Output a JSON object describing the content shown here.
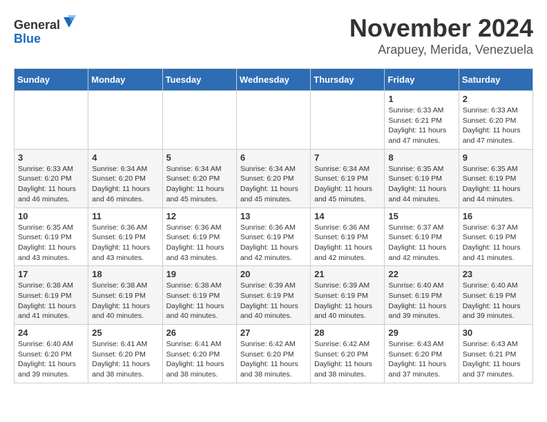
{
  "logo": {
    "general": "General",
    "blue": "Blue"
  },
  "title": "November 2024",
  "location": "Arapuey, Merida, Venezuela",
  "weekdays": [
    "Sunday",
    "Monday",
    "Tuesday",
    "Wednesday",
    "Thursday",
    "Friday",
    "Saturday"
  ],
  "weeks": [
    [
      {
        "day": "",
        "info": ""
      },
      {
        "day": "",
        "info": ""
      },
      {
        "day": "",
        "info": ""
      },
      {
        "day": "",
        "info": ""
      },
      {
        "day": "",
        "info": ""
      },
      {
        "day": "1",
        "info": "Sunrise: 6:33 AM\nSunset: 6:21 PM\nDaylight: 11 hours and 47 minutes."
      },
      {
        "day": "2",
        "info": "Sunrise: 6:33 AM\nSunset: 6:20 PM\nDaylight: 11 hours and 47 minutes."
      }
    ],
    [
      {
        "day": "3",
        "info": "Sunrise: 6:33 AM\nSunset: 6:20 PM\nDaylight: 11 hours and 46 minutes."
      },
      {
        "day": "4",
        "info": "Sunrise: 6:34 AM\nSunset: 6:20 PM\nDaylight: 11 hours and 46 minutes."
      },
      {
        "day": "5",
        "info": "Sunrise: 6:34 AM\nSunset: 6:20 PM\nDaylight: 11 hours and 45 minutes."
      },
      {
        "day": "6",
        "info": "Sunrise: 6:34 AM\nSunset: 6:20 PM\nDaylight: 11 hours and 45 minutes."
      },
      {
        "day": "7",
        "info": "Sunrise: 6:34 AM\nSunset: 6:19 PM\nDaylight: 11 hours and 45 minutes."
      },
      {
        "day": "8",
        "info": "Sunrise: 6:35 AM\nSunset: 6:19 PM\nDaylight: 11 hours and 44 minutes."
      },
      {
        "day": "9",
        "info": "Sunrise: 6:35 AM\nSunset: 6:19 PM\nDaylight: 11 hours and 44 minutes."
      }
    ],
    [
      {
        "day": "10",
        "info": "Sunrise: 6:35 AM\nSunset: 6:19 PM\nDaylight: 11 hours and 43 minutes."
      },
      {
        "day": "11",
        "info": "Sunrise: 6:36 AM\nSunset: 6:19 PM\nDaylight: 11 hours and 43 minutes."
      },
      {
        "day": "12",
        "info": "Sunrise: 6:36 AM\nSunset: 6:19 PM\nDaylight: 11 hours and 43 minutes."
      },
      {
        "day": "13",
        "info": "Sunrise: 6:36 AM\nSunset: 6:19 PM\nDaylight: 11 hours and 42 minutes."
      },
      {
        "day": "14",
        "info": "Sunrise: 6:36 AM\nSunset: 6:19 PM\nDaylight: 11 hours and 42 minutes."
      },
      {
        "day": "15",
        "info": "Sunrise: 6:37 AM\nSunset: 6:19 PM\nDaylight: 11 hours and 42 minutes."
      },
      {
        "day": "16",
        "info": "Sunrise: 6:37 AM\nSunset: 6:19 PM\nDaylight: 11 hours and 41 minutes."
      }
    ],
    [
      {
        "day": "17",
        "info": "Sunrise: 6:38 AM\nSunset: 6:19 PM\nDaylight: 11 hours and 41 minutes."
      },
      {
        "day": "18",
        "info": "Sunrise: 6:38 AM\nSunset: 6:19 PM\nDaylight: 11 hours and 40 minutes."
      },
      {
        "day": "19",
        "info": "Sunrise: 6:38 AM\nSunset: 6:19 PM\nDaylight: 11 hours and 40 minutes."
      },
      {
        "day": "20",
        "info": "Sunrise: 6:39 AM\nSunset: 6:19 PM\nDaylight: 11 hours and 40 minutes."
      },
      {
        "day": "21",
        "info": "Sunrise: 6:39 AM\nSunset: 6:19 PM\nDaylight: 11 hours and 40 minutes."
      },
      {
        "day": "22",
        "info": "Sunrise: 6:40 AM\nSunset: 6:19 PM\nDaylight: 11 hours and 39 minutes."
      },
      {
        "day": "23",
        "info": "Sunrise: 6:40 AM\nSunset: 6:19 PM\nDaylight: 11 hours and 39 minutes."
      }
    ],
    [
      {
        "day": "24",
        "info": "Sunrise: 6:40 AM\nSunset: 6:20 PM\nDaylight: 11 hours and 39 minutes."
      },
      {
        "day": "25",
        "info": "Sunrise: 6:41 AM\nSunset: 6:20 PM\nDaylight: 11 hours and 38 minutes."
      },
      {
        "day": "26",
        "info": "Sunrise: 6:41 AM\nSunset: 6:20 PM\nDaylight: 11 hours and 38 minutes."
      },
      {
        "day": "27",
        "info": "Sunrise: 6:42 AM\nSunset: 6:20 PM\nDaylight: 11 hours and 38 minutes."
      },
      {
        "day": "28",
        "info": "Sunrise: 6:42 AM\nSunset: 6:20 PM\nDaylight: 11 hours and 38 minutes."
      },
      {
        "day": "29",
        "info": "Sunrise: 6:43 AM\nSunset: 6:20 PM\nDaylight: 11 hours and 37 minutes."
      },
      {
        "day": "30",
        "info": "Sunrise: 6:43 AM\nSunset: 6:21 PM\nDaylight: 11 hours and 37 minutes."
      }
    ]
  ]
}
